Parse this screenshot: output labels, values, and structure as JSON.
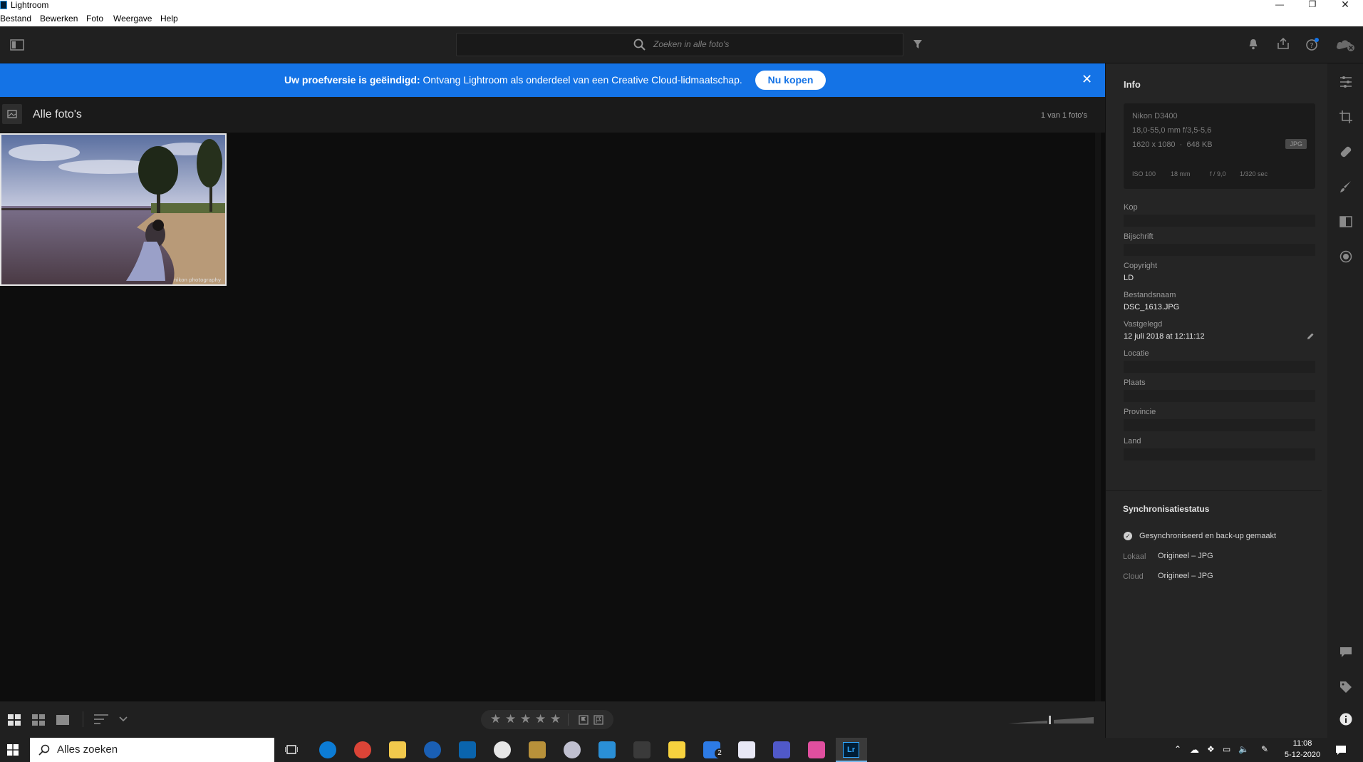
{
  "window": {
    "title": "Lightroom"
  },
  "menu": [
    "Bestand",
    "Bewerken",
    "Foto",
    "Weergave",
    "Help"
  ],
  "search": {
    "placeholder": "Zoeken in alle foto's"
  },
  "banner": {
    "bold": "Uw proefversie is geëindigd:",
    "text": "Ontvang Lightroom als onderdeel van een Creative Cloud-lidmaatschap.",
    "button": "Nu kopen"
  },
  "library": {
    "title": "Alle foto's",
    "count": "1 van 1 foto's"
  },
  "info": {
    "title": "Info",
    "camera": "Nikon D3400",
    "lens": "18,0-55,0 mm f/3,5-5,6",
    "dimensions": "1620 x 1080",
    "filesize": "648 KB",
    "format": "JPG",
    "iso": "ISO 100",
    "focal": "18 mm",
    "aperture": "f / 9,0",
    "shutter": "1/320 sec",
    "fields": {
      "kop": "Kop",
      "bijschrift": "Bijschrift",
      "copyright_label": "Copyright",
      "copyright_value": "LD",
      "bestandsnaam_label": "Bestandsnaam",
      "bestandsnaam_value": "DSC_1613.JPG",
      "vastgelegd_label": "Vastgelegd",
      "vastgelegd_value": "12 juli 2018 at 12:11:12",
      "locatie": "Locatie",
      "plaats": "Plaats",
      "provincie": "Provincie",
      "land": "Land"
    }
  },
  "sync": {
    "title": "Synchronisatiestatus",
    "status": "Gesynchroniseerd en back-up gemaakt",
    "lokaal_label": "Lokaal",
    "lokaal_value": "Origineel – JPG",
    "cloud_label": "Cloud",
    "cloud_value": "Origineel – JPG"
  },
  "taskbar": {
    "search_placeholder": "Alles zoeken",
    "time": "11:08",
    "date": "5-12-2020",
    "badge": "2"
  },
  "colors": {
    "accent": "#1473e6",
    "panel": "#252525",
    "grid": "#0d0d0d"
  }
}
